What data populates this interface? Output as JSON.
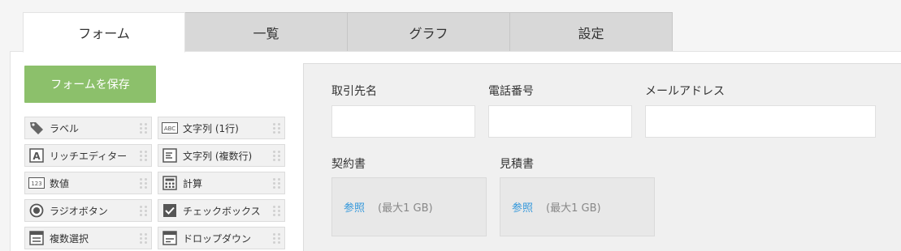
{
  "tabs": [
    {
      "label": "フォーム",
      "active": true
    },
    {
      "label": "一覧",
      "active": false
    },
    {
      "label": "グラフ",
      "active": false
    },
    {
      "label": "設定",
      "active": false
    }
  ],
  "save_button_label": "フォームを保存",
  "palette": [
    {
      "label": "ラベル",
      "icon": "tag-icon"
    },
    {
      "label": "文字列 (1行)",
      "icon": "abc-text-icon"
    },
    {
      "label": "リッチエディター",
      "icon": "rich-editor-icon"
    },
    {
      "label": "文字列 (複数行)",
      "icon": "multiline-text-icon"
    },
    {
      "label": "数値",
      "icon": "number-icon"
    },
    {
      "label": "計算",
      "icon": "calculator-icon"
    },
    {
      "label": "ラジオボタン",
      "icon": "radio-button-icon"
    },
    {
      "label": "チェックボックス",
      "icon": "checkbox-icon"
    },
    {
      "label": "複数選択",
      "icon": "multi-select-icon"
    },
    {
      "label": "ドロップダウン",
      "icon": "dropdown-icon"
    }
  ],
  "form_fields": {
    "client_label": "取引先名",
    "phone_label": "電話番号",
    "email_label": "メールアドレス",
    "contract_label": "契約書",
    "quote_label": "見積書",
    "browse_label": "参照",
    "size_limit": "(最大1 GB)"
  },
  "colors": {
    "save_button": "#8cc06b",
    "link": "#3498db",
    "tab_inactive": "#d8d8d8"
  }
}
